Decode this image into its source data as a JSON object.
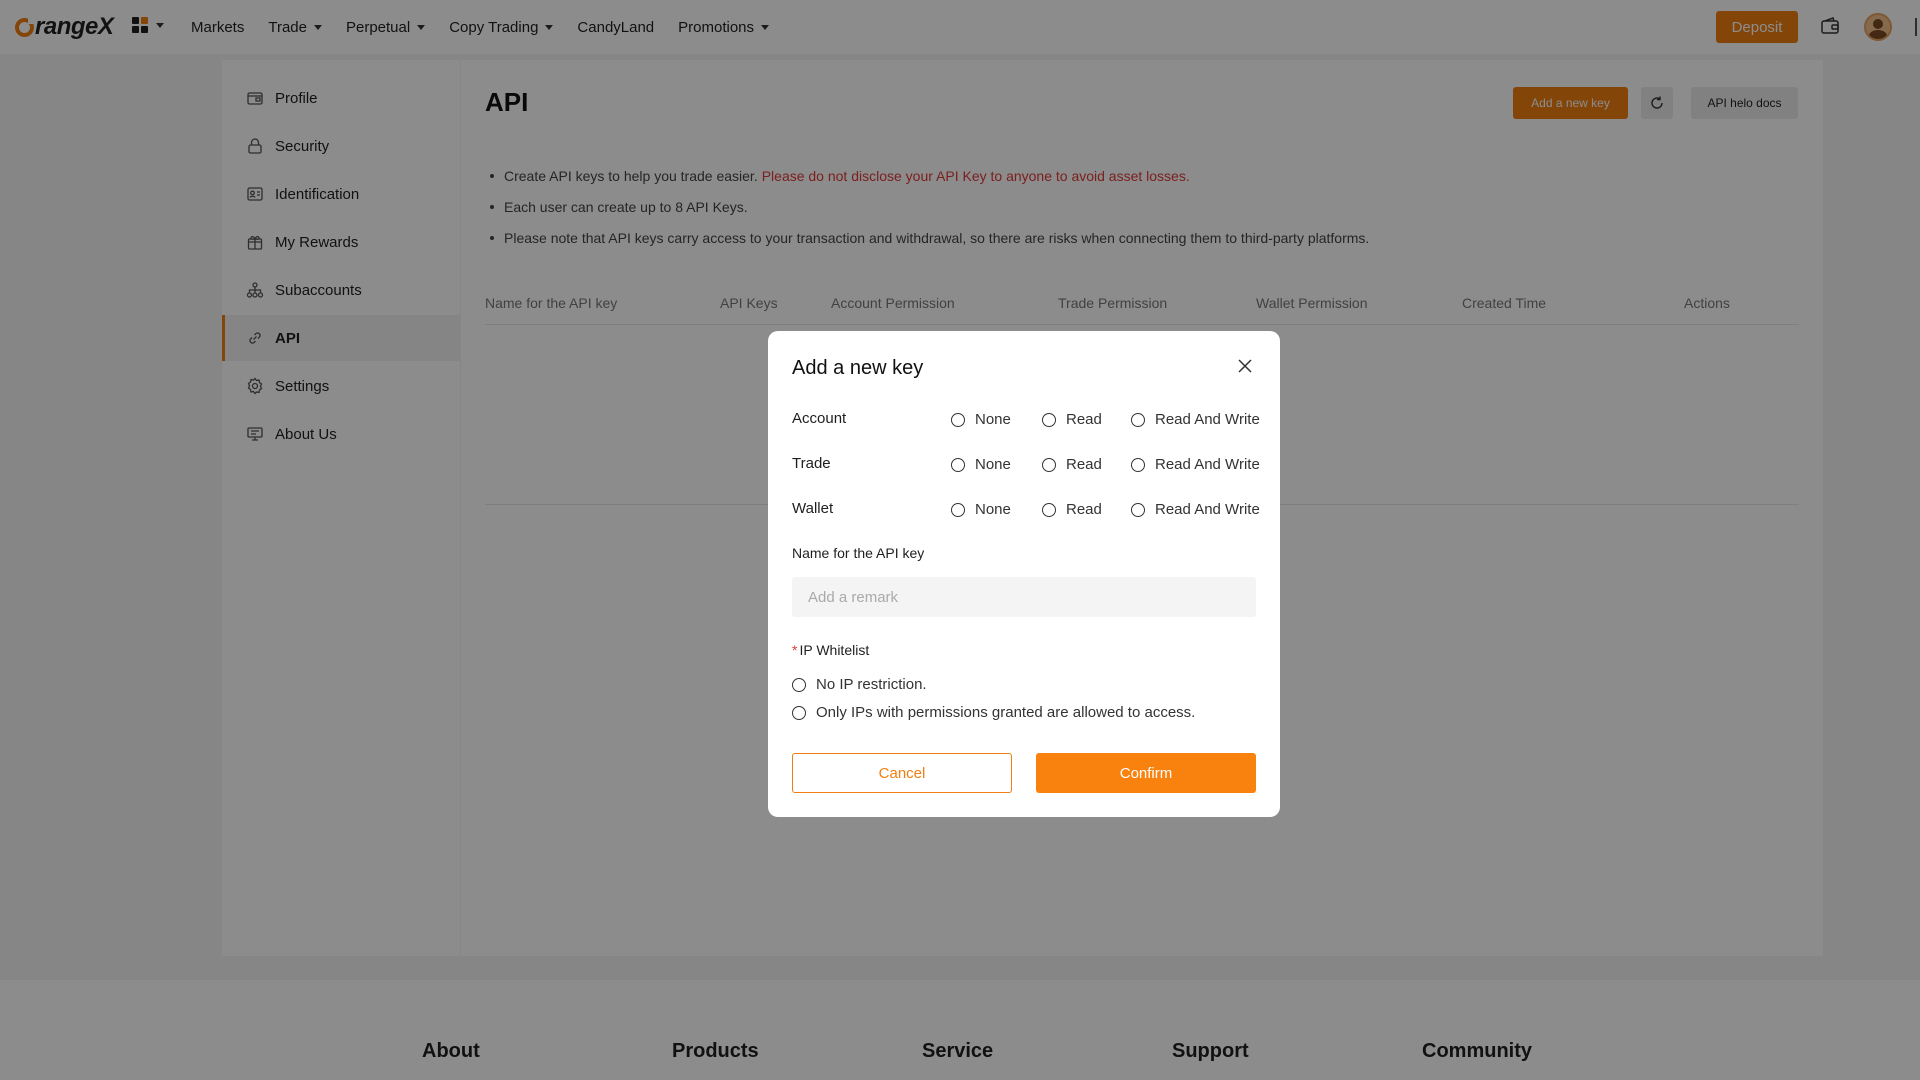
{
  "brand": {
    "logo_text": "rangeX",
    "accent": "#f07e12"
  },
  "topnav": {
    "links": [
      "Markets",
      "Trade",
      "Perpetual",
      "Copy Trading",
      "CandyLand",
      "Promotions"
    ],
    "deposit_label": "Deposit"
  },
  "sidebar": {
    "items": [
      {
        "label": "Profile",
        "icon": "profile-icon"
      },
      {
        "label": "Security",
        "icon": "lock-icon"
      },
      {
        "label": "Identification",
        "icon": "id-card-icon"
      },
      {
        "label": "My Rewards",
        "icon": "gift-icon"
      },
      {
        "label": "Subaccounts",
        "icon": "hierarchy-icon"
      },
      {
        "label": "API",
        "icon": "link-icon",
        "active": true
      },
      {
        "label": "Settings",
        "icon": "gear-icon"
      },
      {
        "label": "About Us",
        "icon": "monitor-icon"
      }
    ]
  },
  "main": {
    "title": "API",
    "add_key_label": "Add a new key",
    "docs_label": "API helo docs",
    "notes": [
      "Create API keys to help you trade easier.",
      "Each user can create up to 8 API Keys.",
      "Please note that API keys carry access to your transaction and withdrawal, so there are risks when connecting them to third-party platforms."
    ],
    "warning": "Please do not disclose your API Key to anyone to avoid asset losses.",
    "table_headers": [
      "Name for the API key",
      "API Keys",
      "Account Permission",
      "Trade Permission",
      "Wallet Permission",
      "Created Time",
      "Actions"
    ]
  },
  "footer": {
    "columns": [
      "About",
      "Products",
      "Service",
      "Support",
      "Community"
    ]
  },
  "modal": {
    "title": "Add a new key",
    "permissions": [
      {
        "label": "Account",
        "options": [
          "None",
          "Read",
          "Read And Write"
        ]
      },
      {
        "label": "Trade",
        "options": [
          "None",
          "Read",
          "Read And Write"
        ]
      },
      {
        "label": "Wallet",
        "options": [
          "None",
          "Read",
          "Read And Write"
        ]
      }
    ],
    "name_label": "Name for the API key",
    "name_placeholder": "Add a remark",
    "ip_label": "IP Whitelist",
    "ip_options": [
      "No IP restriction.",
      "Only IPs with permissions granted are allowed to access."
    ],
    "cancel_label": "Cancel",
    "confirm_label": "Confirm"
  }
}
